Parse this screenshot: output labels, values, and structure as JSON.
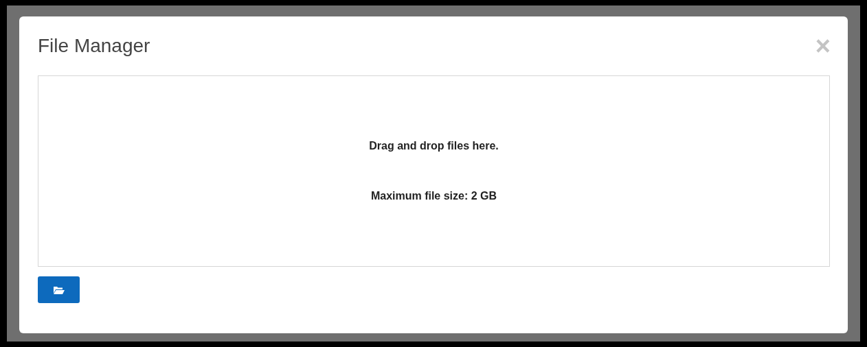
{
  "dialog": {
    "title": "File Manager",
    "close": "×",
    "dropzone": {
      "lines": [
        "Drag and drop files here.",
        "Maximum file size: 2 GB"
      ]
    },
    "buttons": [
      {
        "kind": "browse"
      }
    ]
  }
}
